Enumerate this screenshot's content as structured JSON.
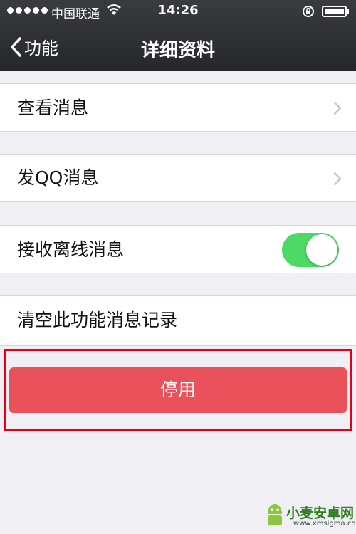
{
  "status_bar": {
    "carrier": "中国联通",
    "time": "14:26"
  },
  "nav": {
    "back_label": "功能",
    "title": "详细资料"
  },
  "cells": {
    "view_messages": "查看消息",
    "send_qq_message": "发QQ消息",
    "receive_offline": "接收离线消息",
    "receive_offline_enabled": true,
    "clear_history": "清空此功能消息记录"
  },
  "disable_button": {
    "label": "停用",
    "color": "#e9525a"
  },
  "annotation": {
    "color": "#e3001b"
  },
  "toggle": {
    "on_color": "#4cd964"
  },
  "watermark": {
    "name": "小麦安卓网",
    "url": "www.xmsigma.com"
  }
}
